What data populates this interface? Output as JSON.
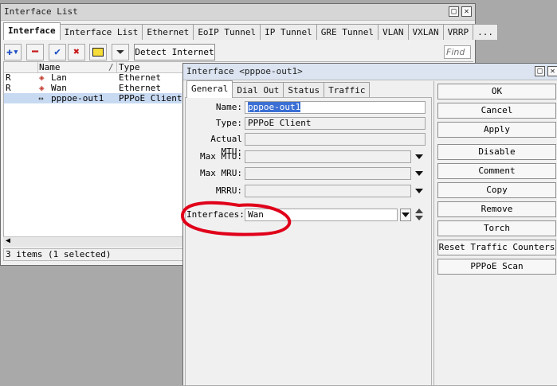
{
  "interface_list": {
    "title": "Interface List",
    "tabs": [
      "Interface",
      "Interface List",
      "Ethernet",
      "EoIP Tunnel",
      "IP Tunnel",
      "GRE Tunnel",
      "VLAN",
      "VXLAN",
      "VRRP",
      "..."
    ],
    "detect_label": "Detect Internet",
    "find_placeholder": "Find",
    "columns": {
      "name": "Name",
      "type": "Type"
    },
    "rows": [
      {
        "flag": "R",
        "name": "Lan",
        "type": "Ethernet"
      },
      {
        "flag": "R",
        "name": "Wan",
        "type": "Ethernet"
      },
      {
        "flag": "",
        "name": "pppoe-out1",
        "type": "PPPoE Client"
      }
    ],
    "status": "3 items (1 selected)"
  },
  "dialog": {
    "title": "Interface <pppoe-out1>",
    "tabs": [
      "General",
      "Dial Out",
      "Status",
      "Traffic"
    ],
    "fields": {
      "name_label": "Name:",
      "name_value": "pppoe-out1",
      "type_label": "Type:",
      "type_value": "PPPoE Client",
      "actual_mtu_label": "Actual MTU:",
      "max_mtu_label": "Max MTU:",
      "max_mru_label": "Max MRU:",
      "mrru_label": "MRRU:",
      "interfaces_label": "Interfaces:",
      "interfaces_value": "Wan"
    },
    "buttons": [
      "OK",
      "Cancel",
      "Apply",
      "Disable",
      "Comment",
      "Copy",
      "Remove",
      "Torch",
      "Reset Traffic Counters",
      "PPPoE Scan"
    ]
  },
  "colors": {
    "annotation": "#e0001a",
    "selected_row": "#c8daf2",
    "name_highlight": "#3b6fd4"
  }
}
